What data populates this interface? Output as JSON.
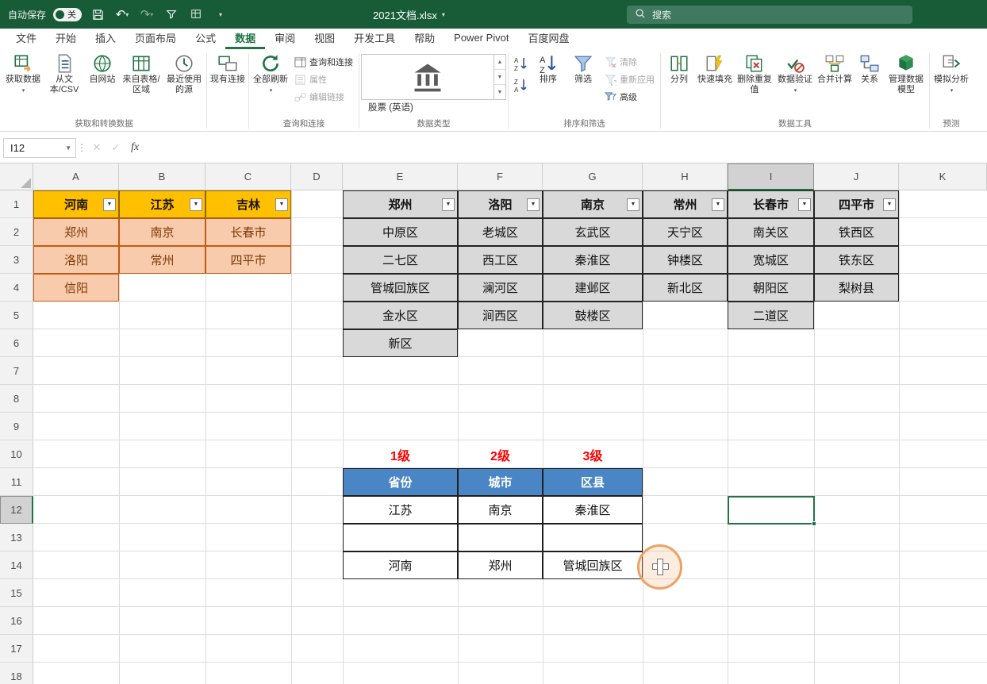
{
  "titlebar": {
    "autosave_label": "自动保存",
    "autosave_state": "关",
    "doc_title": "2021文档.xlsx",
    "search_text": "搜索"
  },
  "menu": {
    "tabs": [
      "文件",
      "开始",
      "插入",
      "页面布局",
      "公式",
      "数据",
      "审阅",
      "视图",
      "开发工具",
      "帮助",
      "Power Pivot",
      "百度网盘"
    ],
    "active_tab": "数据"
  },
  "ribbon": {
    "get_data": "获取数据",
    "from_text_csv": "从文本/CSV",
    "from_web": "自网站",
    "from_table_range": "来自表格/区域",
    "recent_sources": "最近使用的源",
    "existing_connections": "现有连接",
    "refresh_all": "全部刷新",
    "queries_connections": "查询和连接",
    "properties": "属性",
    "edit_links": "编辑链接",
    "data_type_selected": "股票 (英语)",
    "sort": "排序",
    "filter": "筛选",
    "clear": "清除",
    "reapply": "重新应用",
    "advanced": "高级",
    "text_to_columns": "分列",
    "flash_fill": "快速填充",
    "remove_duplicates": "删除重复值",
    "data_validation": "数据验证",
    "consolidate": "合并计算",
    "relationships": "关系",
    "manage_data_model": "管理数据模型",
    "what_if_analysis": "模拟分析",
    "groups": {
      "get_transform": "获取和转换数据",
      "queries": "查询和连接",
      "data_types": "数据类型",
      "sort_filter": "排序和筛选",
      "data_tools": "数据工具",
      "forecast": "预测"
    }
  },
  "formula_bar": {
    "name_box": "I12",
    "fx_label": "fx"
  },
  "grid": {
    "columns": [
      "A",
      "B",
      "C",
      "D",
      "E",
      "F",
      "G",
      "H",
      "I",
      "J",
      "K"
    ],
    "rows": [
      "1",
      "2",
      "3",
      "4",
      "5",
      "6",
      "7",
      "8",
      "9",
      "10",
      "11",
      "12",
      "13",
      "14",
      "15",
      "16",
      "17",
      "18"
    ],
    "selected_cell": "I12"
  },
  "sheet": {
    "province_table": {
      "headers": [
        "河南",
        "江苏",
        "吉林"
      ],
      "cities": {
        "henan": [
          "郑州",
          "洛阳",
          "信阳"
        ],
        "jiangsu": [
          "南京",
          "常州"
        ],
        "jilin": [
          "长春市",
          "四平市"
        ]
      }
    },
    "district_table": {
      "headers": [
        "郑州",
        "洛阳",
        "南京",
        "常州",
        "长春市",
        "四平市"
      ],
      "districts": {
        "zhengzhou": [
          "中原区",
          "二七区",
          "管城回族区",
          "金水区",
          "新区"
        ],
        "luoyang": [
          "老城区",
          "西工区",
          "澜河区",
          "涧西区"
        ],
        "nanjing": [
          "玄武区",
          "秦淮区",
          "建邺区",
          "鼓楼区"
        ],
        "changzhou": [
          "天宁区",
          "钟楼区",
          "新北区"
        ],
        "changchun": [
          "南关区",
          "宽城区",
          "朝阳区",
          "二道区"
        ],
        "siping": [
          "铁西区",
          "铁东区",
          "梨树县"
        ]
      }
    },
    "cascade_table": {
      "level_labels": [
        "1级",
        "2级",
        "3级"
      ],
      "headers": [
        "省份",
        "城市",
        "区县"
      ],
      "rows": [
        [
          "江苏",
          "南京",
          "秦淮区"
        ],
        [
          "",
          "",
          ""
        ],
        [
          "河南",
          "郑州",
          "管城回族区"
        ]
      ]
    }
  },
  "colors": {
    "titlebar_green": "#185c37",
    "accent_green": "#217346",
    "header_gold": "#ffc000",
    "cell_peach": "#f8cbad",
    "cell_gray": "#d9d9d9",
    "header_blue": "#4a86c5",
    "level_red": "#ff0000"
  }
}
